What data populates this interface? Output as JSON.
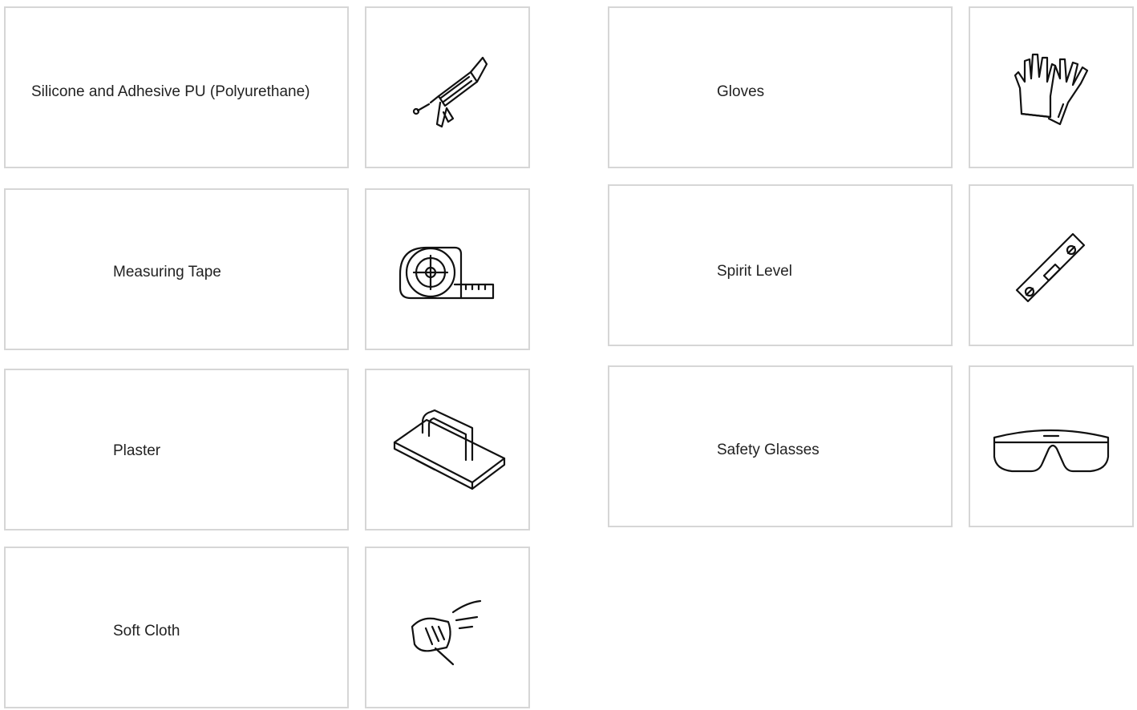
{
  "tools": [
    {
      "label": "Silicone and Adhesive PU (Polyurethane)",
      "icon": "caulking-gun-icon"
    },
    {
      "label": "Measuring Tape",
      "icon": "measuring-tape-icon"
    },
    {
      "label": "Plaster",
      "icon": "plastering-float-icon"
    },
    {
      "label": "Soft Cloth",
      "icon": "wiping-cloth-hand-icon"
    },
    {
      "label": "Gloves",
      "icon": "gloves-icon"
    },
    {
      "label": "Spirit Level",
      "icon": "spirit-level-icon"
    },
    {
      "label": "Safety Glasses",
      "icon": "safety-glasses-icon"
    }
  ]
}
